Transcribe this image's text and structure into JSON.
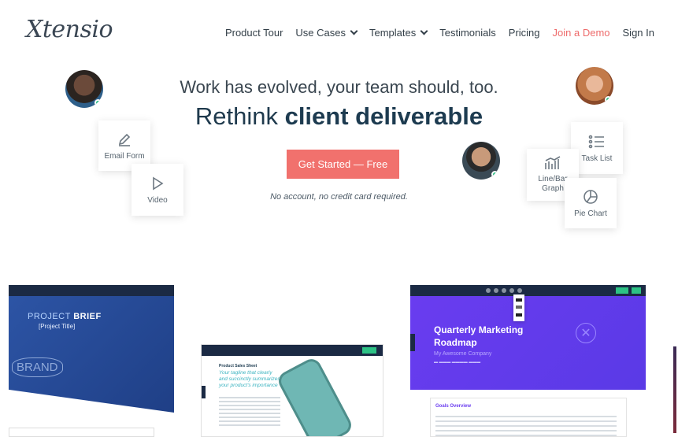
{
  "header": {
    "logo": "Xtensio",
    "nav": [
      {
        "label": "Product Tour",
        "dropdown": false
      },
      {
        "label": "Use Cases",
        "dropdown": true
      },
      {
        "label": "Templates",
        "dropdown": true
      },
      {
        "label": "Testimonials",
        "dropdown": false
      },
      {
        "label": "Pricing",
        "dropdown": false
      },
      {
        "label": "Join a Demo",
        "dropdown": false,
        "accent": "#ee6b6b"
      },
      {
        "label": "Sign In",
        "dropdown": false
      }
    ]
  },
  "hero": {
    "subtitle": "Work has evolved, your team should, too.",
    "title_plain": "Rethink ",
    "title_bold": "client deliverable",
    "cta_label": "Get Started — Free",
    "cta_note": "No account, no credit card required.",
    "cta_color": "#f1716d"
  },
  "cards": {
    "email": {
      "label": "Email Form",
      "icon": "pencil-icon"
    },
    "video": {
      "label": "Video",
      "icon": "play-icon"
    },
    "task": {
      "label": "Task List",
      "icon": "list-icon"
    },
    "bar": {
      "label": "Line/Bar Graph",
      "icon": "bar-graph-icon"
    },
    "pie": {
      "label": "Pie Chart",
      "icon": "pie-chart-icon"
    }
  },
  "previews": {
    "brief": {
      "heading_light": "PROJECT ",
      "heading_bold": "BRIEF",
      "subtitle": "[Project Title]",
      "brand": "BRAND"
    },
    "sales": {
      "heading": "Product Sales Sheet",
      "quote": "Your tagline that clearly and succinctly summarizes your product's importance"
    },
    "roadmap": {
      "title_line1": "Quarterly Marketing",
      "title_line2": "Roadmap",
      "company": "My Awesome Company",
      "goals": "Goals Overview"
    }
  },
  "colors": {
    "status_online": "#2dc285",
    "roadmap_purple": "#6a3cf0"
  }
}
